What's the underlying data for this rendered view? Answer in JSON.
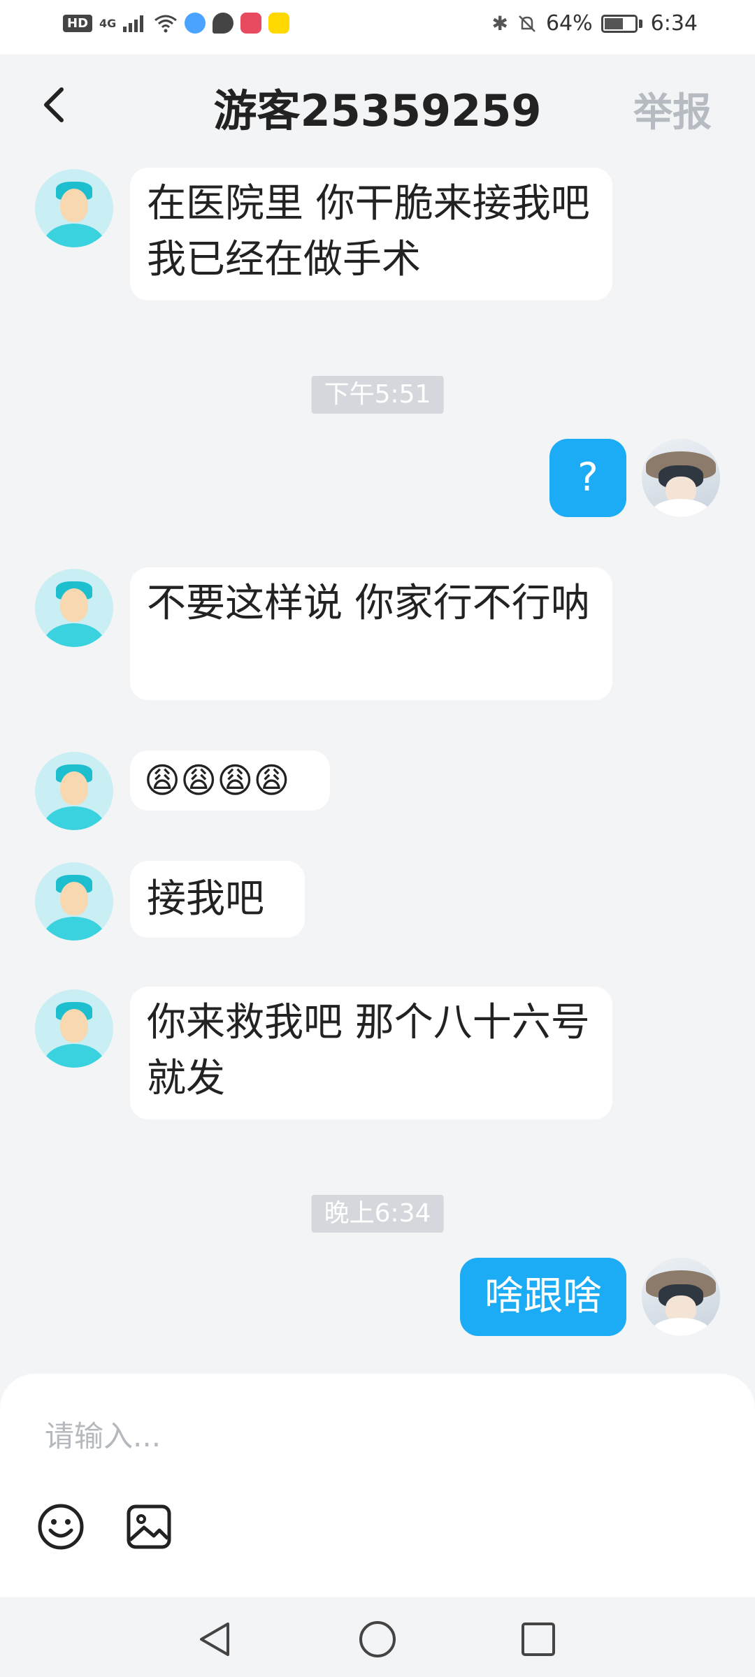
{
  "status_bar": {
    "left_icons": [
      "hd-icon",
      "4g-signal-icon",
      "wifi-icon",
      "browser-app-icon",
      "message-app-icon",
      "huawei-app-icon",
      "kuaishou-app-icon"
    ],
    "hd_label": "HD",
    "network_label": "4G",
    "battery_percent": "64%",
    "battery_level": 0.64,
    "time": "6:34"
  },
  "header": {
    "title": "游客25359259",
    "report_label": "举报"
  },
  "messages": [
    {
      "type": "text",
      "side": "left",
      "text": "在医院里 你干脆来接我吧 我已经在做手术"
    },
    {
      "type": "time",
      "text": "下午5:51"
    },
    {
      "type": "text",
      "side": "right",
      "text": "?"
    },
    {
      "type": "text",
      "side": "left",
      "text": "不要这样说 你家行不行呐"
    },
    {
      "type": "text",
      "side": "left",
      "text": "😩😩😩😩"
    },
    {
      "type": "text",
      "side": "left",
      "text": "接我吧"
    },
    {
      "type": "text",
      "side": "left",
      "text": "你来救我吧 那个八十六号就发"
    },
    {
      "type": "time",
      "text": "晚上6:34"
    },
    {
      "type": "text",
      "side": "right",
      "text": "啥跟啥"
    }
  ],
  "input": {
    "placeholder": "请输入..."
  },
  "colors": {
    "accent": "#1cacf5",
    "background": "#f3f4f6",
    "report_text": "#b6bbc2"
  }
}
